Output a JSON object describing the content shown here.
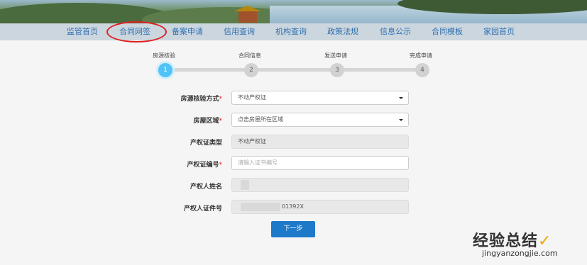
{
  "nav": {
    "items": [
      "监管首页",
      "合同网签",
      "备案申请",
      "信用查询",
      "机构查询",
      "政策法规",
      "信息公示",
      "合同模板",
      "家园首页"
    ],
    "highlighted": "合同网签",
    "highlight_color": "#e02020"
  },
  "steps": {
    "labels": [
      "房源核验",
      "合同信息",
      "发送申请",
      "完成申请"
    ],
    "numbers": [
      "1",
      "2",
      "3",
      "4"
    ],
    "active_index": 0,
    "active_color": "#4fc3f7"
  },
  "form": {
    "source_method": {
      "label": "房源核验方式",
      "value": "不动产权证"
    },
    "district": {
      "label": "房屋区域",
      "value": "点击房屋所在区域"
    },
    "cert_type": {
      "label": "产权证类型",
      "value": "不动产权证"
    },
    "cert_number": {
      "label": "产权证编号",
      "placeholder": "请输入证书编号"
    },
    "owner_name": {
      "label": "产权人姓名",
      "value": ""
    },
    "owner_id": {
      "label": "产权人证件号",
      "value": "01392X"
    },
    "required_mark": "*",
    "next_button": "下一步",
    "button_color": "#1e79c9"
  },
  "watermark": {
    "title": "经验总结",
    "check": "✓",
    "url": "jingyanzongjie.com"
  }
}
